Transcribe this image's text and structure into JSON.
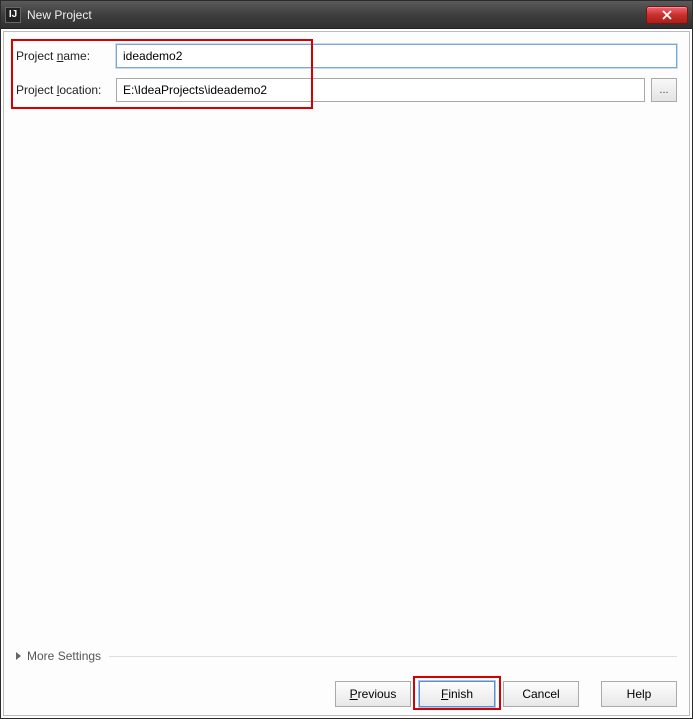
{
  "window": {
    "title": "New Project",
    "app_icon_text": "IJ"
  },
  "form": {
    "project_name_label_pre": "Project ",
    "project_name_label_mn": "n",
    "project_name_label_post": "ame:",
    "project_name_value": "ideademo2",
    "project_location_label_pre": "Project ",
    "project_location_label_mn": "l",
    "project_location_label_post": "ocation:",
    "project_location_value": "E:\\IdeaProjects\\ideademo2",
    "browse_label": "..."
  },
  "more_settings": {
    "label_pre": "Mor",
    "label_mn": "e",
    "label_post": " Settings"
  },
  "buttons": {
    "previous_mn": "P",
    "previous_post": "revious",
    "finish_mn": "F",
    "finish_post": "inish",
    "cancel": "Cancel",
    "help": "Help"
  }
}
